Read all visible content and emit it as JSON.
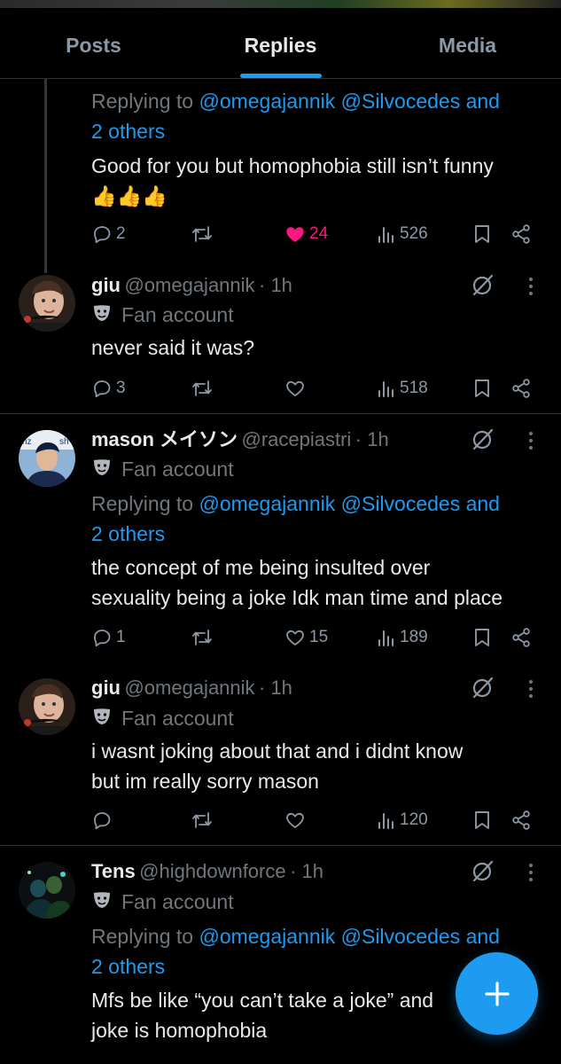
{
  "tabs": [
    {
      "label": "Posts",
      "active": false
    },
    {
      "label": "Replies",
      "active": true
    },
    {
      "label": "Media",
      "active": false
    }
  ],
  "accent_color": "#1d9bf0",
  "like_color": "#f91880",
  "tweets": [
    {
      "replying_prefix": "Replying to",
      "replying_to_line1": "@omegajannik @Silvocedes and",
      "replying_to_line2": "2 others",
      "text_lines": [
        "Good for you but homophobia still isn’t funny",
        "👍👍👍"
      ],
      "replies": "2",
      "likes": "24",
      "liked": true,
      "views": "526"
    },
    {
      "name": "giu",
      "handle": "@omegajannik",
      "time": "· 1h",
      "badge": "Fan account",
      "text_lines": [
        "never said it was?"
      ],
      "replies": "3",
      "likes": "",
      "views": "518"
    },
    {
      "name": "mason メイソン",
      "handle": "@racepiastri",
      "time": "· 1h",
      "badge": "Fan account",
      "replying_prefix": "Replying to",
      "replying_to_line1": "@omegajannik @Silvocedes and",
      "replying_to_line2": "2 others",
      "text_lines": [
        "the concept of me being insulted over",
        "sexuality being a joke Idk man time and place"
      ],
      "replies": "1",
      "likes": "15",
      "views": "189"
    },
    {
      "name": "giu",
      "handle": "@omegajannik",
      "time": "· 1h",
      "badge": "Fan account",
      "text_lines": [
        "i wasnt joking about that and i didnt know",
        "but im really sorry mason"
      ],
      "replies": "",
      "likes": "",
      "views": "120"
    },
    {
      "name": "Tens",
      "handle": "@highdownforce",
      "time": "· 1h",
      "badge": "Fan account",
      "replying_prefix": "Replying to",
      "replying_to_line1": "@omegajannik @Silvocedes and",
      "replying_to_line2": "2 others",
      "text_lines": [
        "Mfs be like “you can’t take a joke” and",
        "joke is homophobia"
      ]
    }
  ],
  "fab_label": "+"
}
